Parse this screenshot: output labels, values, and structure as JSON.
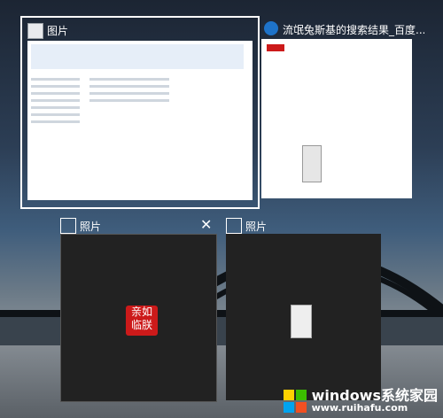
{
  "windows": [
    {
      "title": "图片",
      "icon": "file-explorer-icon"
    },
    {
      "title": "流氓兔斯基的搜索结果_百度...",
      "icon": "edge-browser-icon"
    },
    {
      "title": "照片",
      "icon": "photos-app-icon"
    },
    {
      "title": "照片",
      "icon": "photos-app-icon"
    }
  ],
  "stamp": {
    "line1": "亲如",
    "line2": "临朕"
  },
  "watermark": {
    "brand": "windows系统家园",
    "url": "www.ruihafu.com"
  },
  "colors": {
    "selection": "#ffffff",
    "stamp_red": "#cc1a1a",
    "edge_blue": "#1e73c9"
  }
}
